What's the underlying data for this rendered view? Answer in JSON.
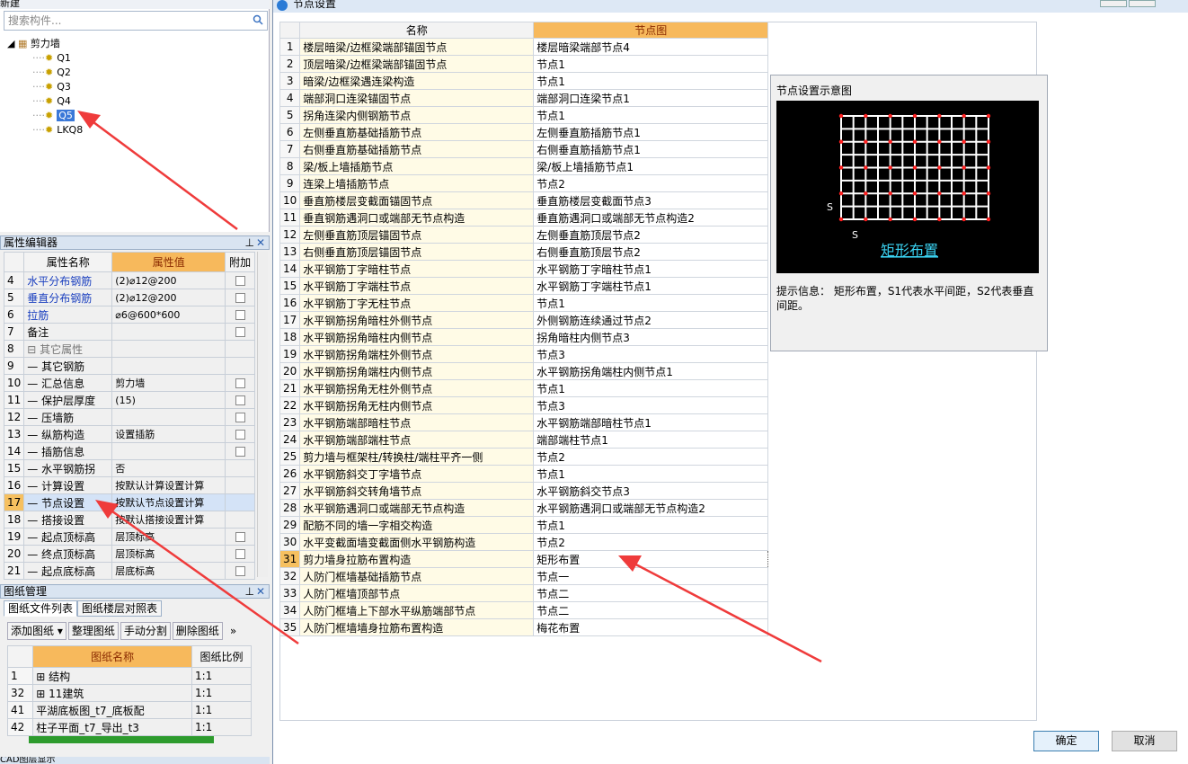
{
  "left_panel": {
    "toolbar_new": "新建",
    "search_placeholder": "搜索构件...",
    "tree": {
      "root": "剪力墙",
      "items": [
        "Q1",
        "Q2",
        "Q3",
        "Q4",
        "Q5",
        "LKQ8"
      ],
      "selected": "Q5"
    }
  },
  "property_editor": {
    "title": "属性编辑器",
    "columns": [
      "属性名称",
      "属性值",
      "附加"
    ],
    "rows": [
      {
        "num": "4",
        "name": "水平分布钢筋",
        "value": "(2)⌀12@200",
        "style": "blue",
        "check": true
      },
      {
        "num": "5",
        "name": "垂直分布钢筋",
        "value": "(2)⌀12@200",
        "style": "blue",
        "check": true
      },
      {
        "num": "6",
        "name": "拉筋",
        "value": "⌀6@600*600",
        "style": "blue",
        "check": true
      },
      {
        "num": "7",
        "name": "备注",
        "value": "",
        "style": "",
        "check": true
      },
      {
        "num": "8",
        "name": "⊟ 其它属性",
        "value": "",
        "style": "grey",
        "check": false
      },
      {
        "num": "9",
        "name": "— 其它钢筋",
        "value": "",
        "style": "",
        "check": false
      },
      {
        "num": "10",
        "name": "— 汇总信息",
        "value": "剪力墙",
        "style": "",
        "check": true
      },
      {
        "num": "11",
        "name": "— 保护层厚度",
        "value": "(15)",
        "style": "",
        "check": true
      },
      {
        "num": "12",
        "name": "— 压墙筋",
        "value": "",
        "style": "",
        "check": true
      },
      {
        "num": "13",
        "name": "— 纵筋构造",
        "value": "设置插筋",
        "style": "",
        "check": true
      },
      {
        "num": "14",
        "name": "— 插筋信息",
        "value": "",
        "style": "",
        "check": true
      },
      {
        "num": "15",
        "name": "— 水平钢筋拐",
        "value": "否",
        "style": "",
        "check": false
      },
      {
        "num": "16",
        "name": "— 计算设置",
        "value": "按默认计算设置计算",
        "style": "",
        "check": false
      },
      {
        "num": "17",
        "name": "— 节点设置",
        "value": "按默认节点设置计算",
        "style": "cur",
        "check": false
      },
      {
        "num": "18",
        "name": "— 搭接设置",
        "value": "按默认搭接设置计算",
        "style": "",
        "check": false
      },
      {
        "num": "19",
        "name": "— 起点顶标高",
        "value": "层顶标高",
        "style": "",
        "check": true
      },
      {
        "num": "20",
        "name": "— 终点顶标高",
        "value": "层顶标高",
        "style": "",
        "check": true
      },
      {
        "num": "21",
        "name": "— 起点底标高",
        "value": "层底标高",
        "style": "",
        "check": true
      }
    ]
  },
  "drawing_mgmt": {
    "title": "图纸管理",
    "tabs": [
      "图纸文件列表",
      "图纸楼层对照表"
    ],
    "buttons": [
      "添加图纸",
      "整理图纸",
      "手动分割",
      "删除图纸"
    ],
    "columns": [
      "图纸名称",
      "图纸比例"
    ],
    "rows": [
      {
        "num": "1",
        "name": "⊞ 结构",
        "scale": "1:1"
      },
      {
        "num": "32",
        "name": "⊞ 11建筑",
        "scale": "1:1"
      },
      {
        "num": "41",
        "name": "平湖底板图_t7_底板配",
        "scale": "1:1"
      },
      {
        "num": "42",
        "name": "柱子平面_t7_导出_t3",
        "scale": "1:1"
      }
    ],
    "cad_title": "CAD图层显示"
  },
  "dialog": {
    "title": "节点设置",
    "columns": [
      "名称",
      "节点图"
    ],
    "rows": [
      [
        "1",
        "楼层暗梁/边框梁端部锚固节点",
        "楼层暗梁端部节点4"
      ],
      [
        "2",
        "顶层暗梁/边框梁端部锚固节点",
        "节点1"
      ],
      [
        "3",
        "暗梁/边框梁遇连梁构造",
        "节点1"
      ],
      [
        "4",
        "端部洞口连梁锚固节点",
        "端部洞口连梁节点1"
      ],
      [
        "5",
        "拐角连梁内侧钢筋节点",
        "节点1"
      ],
      [
        "6",
        "左侧垂直筋基础插筋节点",
        "左侧垂直筋插筋节点1"
      ],
      [
        "7",
        "右侧垂直筋基础插筋节点",
        "右侧垂直筋插筋节点1"
      ],
      [
        "8",
        "梁/板上墙插筋节点",
        "梁/板上墙插筋节点1"
      ],
      [
        "9",
        "连梁上墙插筋节点",
        "节点2"
      ],
      [
        "10",
        "垂直筋楼层变截面锚固节点",
        "垂直筋楼层变截面节点3"
      ],
      [
        "11",
        "垂直钢筋遇洞口或端部无节点构造",
        "垂直筋遇洞口或端部无节点构造2"
      ],
      [
        "12",
        "左侧垂直筋顶层锚固节点",
        "左侧垂直筋顶层节点2"
      ],
      [
        "13",
        "右侧垂直筋顶层锚固节点",
        "右侧垂直筋顶层节点2"
      ],
      [
        "14",
        "水平钢筋丁字暗柱节点",
        "水平钢筋丁字暗柱节点1"
      ],
      [
        "15",
        "水平钢筋丁字端柱节点",
        "水平钢筋丁字端柱节点1"
      ],
      [
        "16",
        "水平钢筋丁字无柱节点",
        "节点1"
      ],
      [
        "17",
        "水平钢筋拐角暗柱外侧节点",
        "外侧钢筋连续通过节点2"
      ],
      [
        "18",
        "水平钢筋拐角暗柱内侧节点",
        "拐角暗柱内侧节点3"
      ],
      [
        "19",
        "水平钢筋拐角端柱外侧节点",
        "节点3"
      ],
      [
        "20",
        "水平钢筋拐角端柱内侧节点",
        "水平钢筋拐角端柱内侧节点1"
      ],
      [
        "21",
        "水平钢筋拐角无柱外侧节点",
        "节点1"
      ],
      [
        "22",
        "水平钢筋拐角无柱内侧节点",
        "节点3"
      ],
      [
        "23",
        "水平钢筋端部暗柱节点",
        "水平钢筋端部暗柱节点1"
      ],
      [
        "24",
        "水平钢筋端部端柱节点",
        "端部端柱节点1"
      ],
      [
        "25",
        "剪力墙与框架柱/转换柱/端柱平齐一侧",
        "节点2"
      ],
      [
        "26",
        "水平钢筋斜交丁字墙节点",
        "节点1"
      ],
      [
        "27",
        "水平钢筋斜交转角墙节点",
        "水平钢筋斜交节点3"
      ],
      [
        "28",
        "水平钢筋遇洞口或端部无节点构造",
        "水平钢筋遇洞口或端部无节点构造2"
      ],
      [
        "29",
        "配筋不同的墙一字相交构造",
        "节点1"
      ],
      [
        "30",
        "水平变截面墙变截面侧水平钢筋构造",
        "节点2"
      ],
      [
        "31",
        "剪力墙身拉筋布置构造",
        "矩形布置"
      ],
      [
        "32",
        "人防门框墙基础插筋节点",
        "节点一"
      ],
      [
        "33",
        "人防门框墙顶部节点",
        "节点二"
      ],
      [
        "34",
        "人防门框墙上下部水平纵筋端部节点",
        "节点二"
      ],
      [
        "35",
        "人防门框墙墙身拉筋布置构造",
        "梅花布置"
      ]
    ],
    "current_row": "31",
    "preview": {
      "title": "节点设置示意图",
      "caption": "矩形布置",
      "label_s": "S",
      "info": "提示信息： 矩形布置，S1代表水平间距，S2代表垂直间距。"
    },
    "ok": "确定",
    "cancel": "取消"
  },
  "colors": {
    "accent": "#f7b95c",
    "arrow": "#ef3b3b",
    "selection": "#3a78d8"
  }
}
